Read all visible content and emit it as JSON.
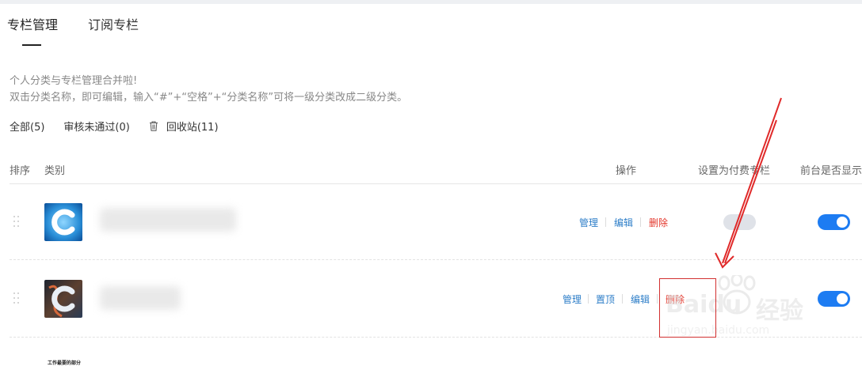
{
  "tabs": [
    {
      "label": "专栏管理",
      "active": true
    },
    {
      "label": "订阅专栏",
      "active": false
    }
  ],
  "notice": {
    "line1": "个人分类与专栏管理合并啦!",
    "line2": "双击分类名称，即可编辑，输入“#”+“空格”+“分类名称”可将一级分类改成二级分类。"
  },
  "filters": {
    "all": "全部(5)",
    "rejected": "审核未通过(0)",
    "recycle": "回收站(11)"
  },
  "table_header": {
    "order": "排序",
    "category": "类别",
    "actions": "操作",
    "paid": "设置为付费专栏",
    "visible": "前台是否显示"
  },
  "rows": [
    {
      "actions": {
        "manage": "管理",
        "edit": "编辑",
        "delete": "删除"
      },
      "paid": false,
      "visible": true
    },
    {
      "actions": {
        "manage": "管理",
        "pin": "置顶",
        "edit": "编辑",
        "delete": "删除"
      },
      "paid": false,
      "visible": true
    }
  ],
  "footer_text": "工作最要的部分",
  "watermark": {
    "brand": "Baidu",
    "suffix": "经验",
    "url": "jingyan.baidu.com"
  },
  "colors": {
    "link": "#2d7ec8",
    "danger": "#e3352a",
    "switch_on": "#1d7cf2",
    "switch_off": "#dfe2e8",
    "annotation": "#d23030"
  }
}
